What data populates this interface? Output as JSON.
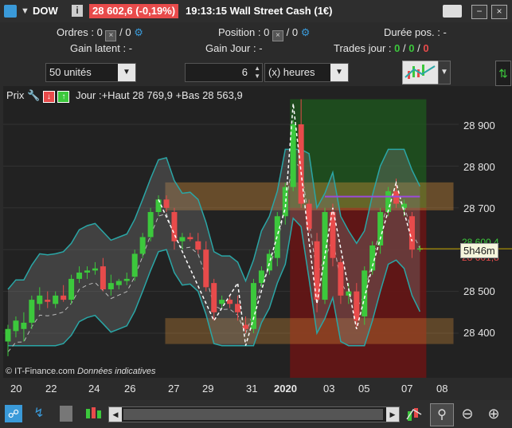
{
  "title": {
    "symbol": "DOW",
    "info_icon": "i",
    "price": "28 602,6",
    "change": "(-0,19%)",
    "time_name": "19:13:15 Wall Street Cash (1€)"
  },
  "info": {
    "orders_label": "Ordres :",
    "orders_val1": "0",
    "orders_val2": "0",
    "position_label": "Position :",
    "position_val1": "0",
    "position_val2": "0",
    "duree_label": "Durée pos. :",
    "duree_val": "-",
    "gain_latent_label": "Gain latent :",
    "gain_latent_val": "-",
    "gain_jour_label": "Gain Jour :",
    "gain_jour_val": "-",
    "trades_label": "Trades jour :",
    "trades_v1": "0",
    "trades_v2": "0",
    "trades_v3": "0",
    "slash": "/"
  },
  "controls": {
    "units": "50 unités",
    "period_value": "6",
    "period_unit": "(x) heures"
  },
  "chart_header": {
    "prix": "Prix",
    "jour": "Jour :+Haut 28 769,9 +Bas 28 563,9"
  },
  "watermark": {
    "brand": "© IT-Finance.com",
    "note": "Données indicatives"
  },
  "price_axis": {
    "ticks": [
      "28 900",
      "28 800",
      "28 700",
      "28 600,4",
      "28 500",
      "28 400"
    ],
    "last_price": "28 601,8",
    "timer": "5h46m"
  },
  "time_axis": [
    "20",
    "22",
    "24",
    "26",
    "27",
    "29",
    "31",
    "2020",
    "03",
    "05",
    "07",
    "08"
  ],
  "chart_data": {
    "type": "candlestick",
    "y_ticks": [
      28400,
      28500,
      28600,
      28700,
      28800,
      28900
    ],
    "ylim": [
      28330,
      28980
    ],
    "x_labels": [
      "20",
      "22",
      "24",
      "26",
      "27",
      "29",
      "31",
      "2020",
      "03",
      "05",
      "07",
      "08"
    ],
    "day_high": 28769.9,
    "day_low": 28563.9,
    "last": 28602.6,
    "colors": {
      "up": "#3cc83c",
      "down": "#e84b4b",
      "zone": "#e89a3c",
      "band_line": "#2aa6a6"
    },
    "candles": [
      {
        "o": 28380,
        "h": 28420,
        "l": 28345,
        "c": 28410
      },
      {
        "o": 28405,
        "h": 28440,
        "l": 28390,
        "c": 28430
      },
      {
        "o": 28410,
        "h": 28450,
        "l": 28380,
        "c": 28425
      },
      {
        "o": 28425,
        "h": 28490,
        "l": 28410,
        "c": 28480
      },
      {
        "o": 28470,
        "h": 28510,
        "l": 28455,
        "c": 28490
      },
      {
        "o": 28480,
        "h": 28500,
        "l": 28460,
        "c": 28475
      },
      {
        "o": 28470,
        "h": 28500,
        "l": 28460,
        "c": 28490
      },
      {
        "o": 28490,
        "h": 28515,
        "l": 28475,
        "c": 28480
      },
      {
        "o": 28480,
        "h": 28540,
        "l": 28470,
        "c": 28530
      },
      {
        "o": 28530,
        "h": 28560,
        "l": 28520,
        "c": 28545
      },
      {
        "o": 28545,
        "h": 28560,
        "l": 28530,
        "c": 28550
      },
      {
        "o": 28550,
        "h": 28570,
        "l": 28540,
        "c": 28555
      },
      {
        "o": 28560,
        "h": 28580,
        "l": 28500,
        "c": 28505
      },
      {
        "o": 28505,
        "h": 28540,
        "l": 28490,
        "c": 28520
      },
      {
        "o": 28515,
        "h": 28530,
        "l": 28505,
        "c": 28525
      },
      {
        "o": 28525,
        "h": 28545,
        "l": 28515,
        "c": 28530
      },
      {
        "o": 28535,
        "h": 28600,
        "l": 28525,
        "c": 28590
      },
      {
        "o": 28590,
        "h": 28640,
        "l": 28580,
        "c": 28630
      },
      {
        "o": 28630,
        "h": 28700,
        "l": 28620,
        "c": 28690
      },
      {
        "o": 28690,
        "h": 28730,
        "l": 28680,
        "c": 28720
      },
      {
        "o": 28720,
        "h": 28730,
        "l": 28690,
        "c": 28700
      },
      {
        "o": 28690,
        "h": 28700,
        "l": 28600,
        "c": 28620
      },
      {
        "o": 28620,
        "h": 28640,
        "l": 28600,
        "c": 28630
      },
      {
        "o": 28630,
        "h": 28640,
        "l": 28620,
        "c": 28625
      },
      {
        "o": 28620,
        "h": 28640,
        "l": 28590,
        "c": 28600
      },
      {
        "o": 28600,
        "h": 28620,
        "l": 28500,
        "c": 28510
      },
      {
        "o": 28520,
        "h": 28530,
        "l": 28430,
        "c": 28450
      },
      {
        "o": 28470,
        "h": 28490,
        "l": 28460,
        "c": 28480
      },
      {
        "o": 28480,
        "h": 28490,
        "l": 28460,
        "c": 28470
      },
      {
        "o": 28470,
        "h": 28490,
        "l": 28430,
        "c": 28450
      },
      {
        "o": 28420,
        "h": 28440,
        "l": 28400,
        "c": 28410
      },
      {
        "o": 28410,
        "h": 28530,
        "l": 28400,
        "c": 28520
      },
      {
        "o": 28520,
        "h": 28560,
        "l": 28510,
        "c": 28550
      },
      {
        "o": 28550,
        "h": 28600,
        "l": 28540,
        "c": 28590
      },
      {
        "o": 28580,
        "h": 28690,
        "l": 28560,
        "c": 28680
      },
      {
        "o": 28680,
        "h": 28760,
        "l": 28660,
        "c": 28750
      },
      {
        "o": 28750,
        "h": 28910,
        "l": 28740,
        "c": 28900
      },
      {
        "o": 28900,
        "h": 28960,
        "l": 28700,
        "c": 28710
      },
      {
        "o": 28710,
        "h": 28720,
        "l": 28640,
        "c": 28650
      },
      {
        "o": 28620,
        "h": 28640,
        "l": 28450,
        "c": 28480
      },
      {
        "o": 28480,
        "h": 28700,
        "l": 28470,
        "c": 28690
      },
      {
        "o": 28690,
        "h": 28710,
        "l": 28560,
        "c": 28580
      },
      {
        "o": 28570,
        "h": 28580,
        "l": 28470,
        "c": 28490
      },
      {
        "o": 28490,
        "h": 28520,
        "l": 28470,
        "c": 28500
      },
      {
        "o": 28500,
        "h": 28520,
        "l": 28410,
        "c": 28430
      },
      {
        "o": 28440,
        "h": 28560,
        "l": 28420,
        "c": 28550
      },
      {
        "o": 28550,
        "h": 28620,
        "l": 28540,
        "c": 28610
      },
      {
        "o": 28610,
        "h": 28700,
        "l": 28590,
        "c": 28690
      },
      {
        "o": 28690,
        "h": 28750,
        "l": 28680,
        "c": 28740
      },
      {
        "o": 28740,
        "h": 28770,
        "l": 28700,
        "c": 28710
      },
      {
        "o": 28700,
        "h": 28720,
        "l": 28680,
        "c": 28710
      },
      {
        "o": 28680,
        "h": 28690,
        "l": 28580,
        "c": 28600
      },
      {
        "o": 28600,
        "h": 28610,
        "l": 28595,
        "c": 28603
      }
    ]
  }
}
